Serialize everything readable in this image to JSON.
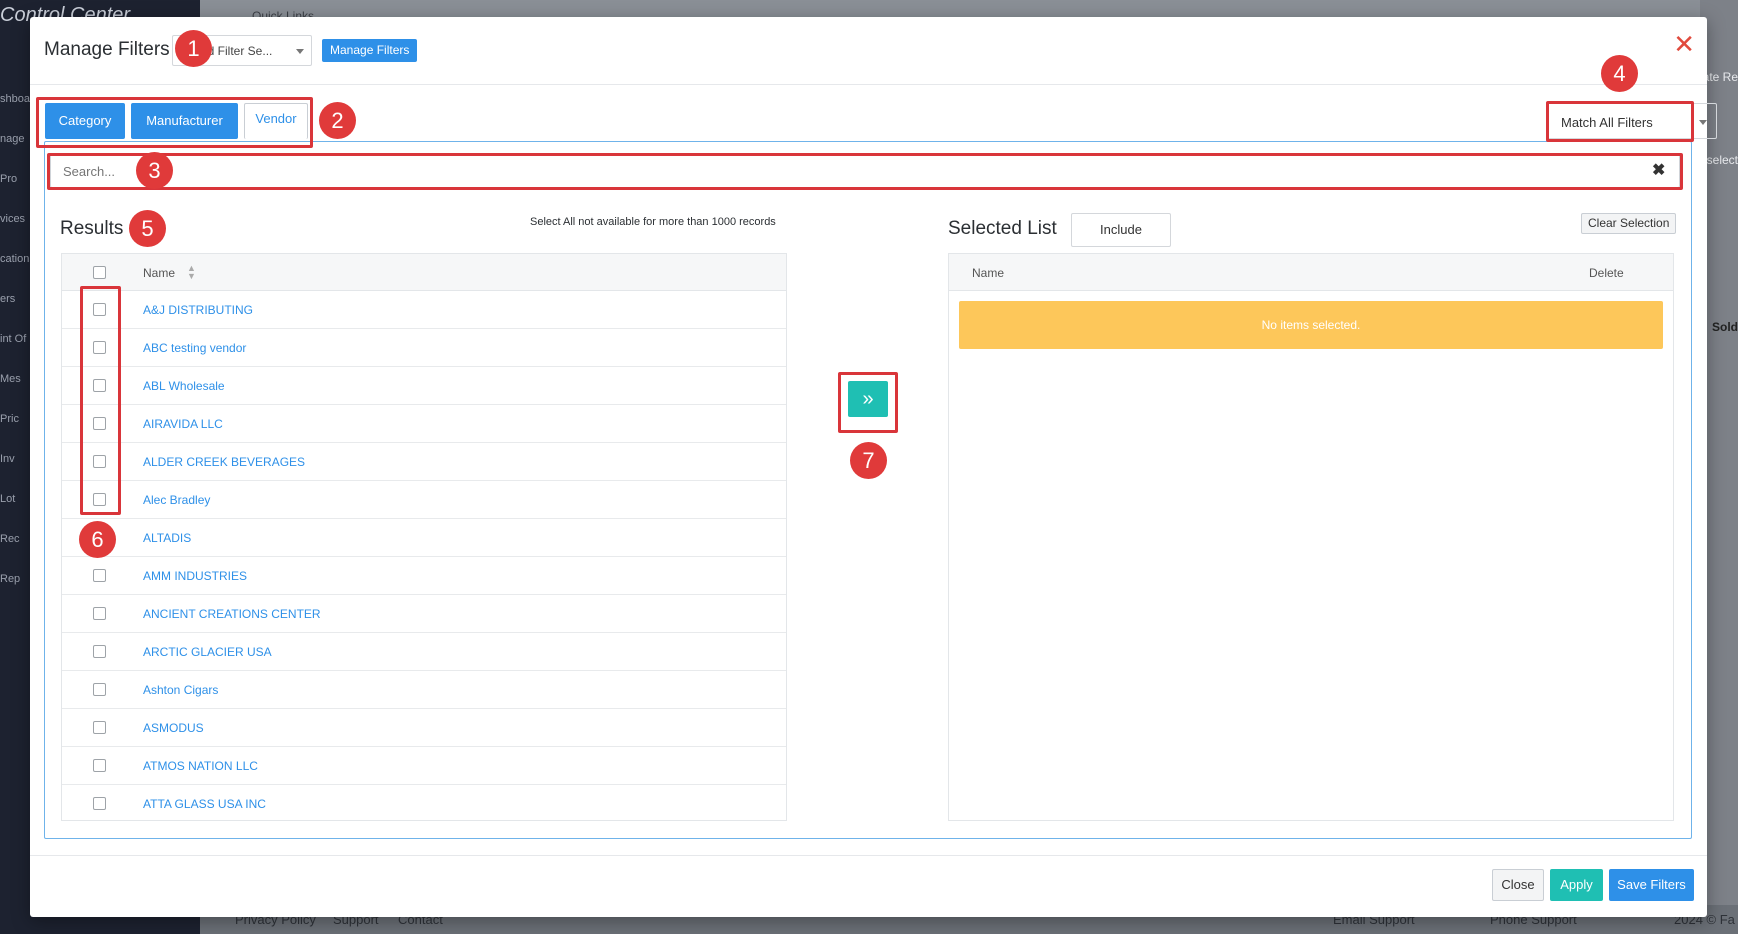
{
  "background": {
    "brand": "Control Center",
    "quick_links": "Quick Links",
    "nav_fragments": [
      "shboa",
      "nage",
      "Pro",
      "vices",
      "cation",
      "ers",
      "int Of",
      "Mes",
      "Pric",
      "Inv",
      "Lot",
      "Rec",
      "Rep"
    ],
    "right_fragments": [
      "ate Re",
      "select",
      "Sold"
    ],
    "footer": {
      "privacy": "Privacy Policy",
      "support": "Support",
      "contact": "Contact",
      "email_support": "Email Support",
      "phone_support": "Phone Support",
      "copyright": "2024 © Fa"
    }
  },
  "modal": {
    "title": "Manage Filters",
    "saved_filter_placeholder": "ved Filter Se...",
    "manage_filters_button": "Manage Filters",
    "close_glyph": "✕",
    "tabs": [
      {
        "label": "Category",
        "active": true
      },
      {
        "label": "Manufacturer",
        "active": true
      },
      {
        "label": "Vendor",
        "active": false
      }
    ],
    "match_mode": "Match All Filters",
    "search_placeholder": "Search...",
    "search_clear_glyph": "✖"
  },
  "results": {
    "title": "Results",
    "note": "Select All not available for more than 1000 records",
    "column_name": "Name",
    "rows": [
      "A&J DISTRIBUTING",
      "ABC testing vendor",
      "ABL Wholesale",
      "AIRAVIDA LLC",
      "ALDER CREEK BEVERAGES",
      "Alec Bradley",
      "ALTADIS",
      "AMM INDUSTRIES",
      "ANCIENT CREATIONS CENTER",
      "ARCTIC GLACIER USA",
      "Ashton Cigars",
      "ASMODUS",
      "ATMOS NATION LLC",
      "ATTA GLASS USA INC"
    ]
  },
  "move_button_glyph": "»",
  "selected": {
    "title": "Selected List",
    "include_label": "Include",
    "clear_label": "Clear Selection",
    "column_name": "Name",
    "column_delete": "Delete",
    "empty_message": "No items selected."
  },
  "footer_buttons": {
    "close": "Close",
    "apply": "Apply",
    "save": "Save Filters"
  },
  "annotations": [
    "1",
    "2",
    "3",
    "4",
    "5",
    "6",
    "7"
  ],
  "colors": {
    "primary": "#2e90e8",
    "teal": "#1fbfb3",
    "warning": "#fdc75a",
    "annotation_red": "#d9353a"
  }
}
